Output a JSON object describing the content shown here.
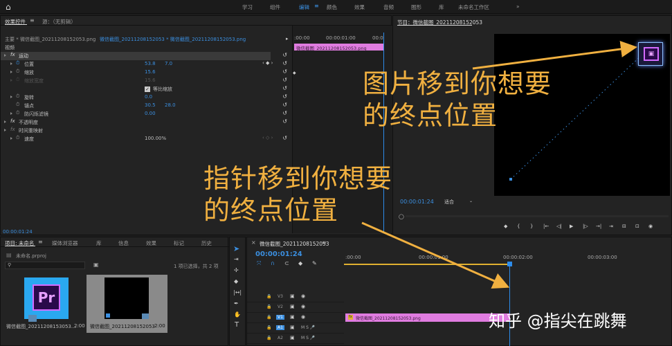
{
  "topbar": {
    "home_icon": "home-icon",
    "nav": [
      "学习",
      "组件",
      "编辑",
      "颜色",
      "效果",
      "音频",
      "图形",
      "库",
      "未命名工作区",
      "»"
    ],
    "active_index": 2
  },
  "effect_controls": {
    "tab_label": "效果控件",
    "tab2_label": "源：（无剪辑）",
    "header_source": "主要 * 微信截图_20211208152053.png",
    "header_clip": "微信截图_20211208152053 * 微信截图_20211208152053.png",
    "section_video": "视频",
    "motion": {
      "label": "运动",
      "position_label": "位置",
      "position_x": "53.8",
      "position_y": "7.0",
      "scale_label": "缩放",
      "scale_value": "15.6",
      "scale_width_label": "缩放宽度",
      "scale_width_value": "15.6",
      "uniform_scale_label": "等比缩放",
      "rotation_label": "旋转",
      "rotation_value": "0.0",
      "anchor_label": "锚点",
      "anchor_x": "30.5",
      "anchor_y": "28.0",
      "antiflicker_label": "防闪烁滤镜",
      "antiflicker_value": "0.00"
    },
    "opacity_label": "不透明度",
    "time_remap_label": "时间重映射",
    "speed_label": "速度",
    "speed_value": "100.00%",
    "timecode": "00:00:01:24",
    "mini_timeline": {
      "start": ":00:00",
      "mid": "00:00:01:00",
      "end": "00:0",
      "clip_label": "微信截图_20211208152053.png"
    }
  },
  "program_monitor": {
    "title": "节目：微信截图_20211208152053",
    "timecode": "00:00:01:24",
    "fit_label": "适合",
    "transport": [
      "◆",
      "{",
      "}",
      "|←",
      "◁|",
      "▶",
      "|▷",
      "→|",
      "⇥",
      "⊟",
      "⊡",
      "◉"
    ]
  },
  "project_panel": {
    "tab_label": "项目: 未命名",
    "tabs": [
      "媒体浏览器",
      "库",
      "信息",
      "效果",
      "标记",
      "历史"
    ],
    "project_file": "未命名.prproj",
    "selection_info": "1 项已选择，共 2 项",
    "items": [
      {
        "name": "微信截图_20211208153053...",
        "duration": "2:00"
      },
      {
        "name": "微信截图_20211208152053",
        "duration": "2:00"
      }
    ]
  },
  "timeline": {
    "title": "微信截图_20211208152053",
    "timecode": "00:00:01:24",
    "ruler": [
      ":00:00",
      "00:00:01:00",
      "00:00:02:00",
      "00:00:03:00"
    ],
    "tracks": [
      "V3",
      "V2",
      "V1",
      "A1",
      "A2"
    ],
    "clip_label": "微信截图_20211208152053.png"
  },
  "annotations": {
    "text1_line1": "图片移到你想要",
    "text1_line2": "的终点位置",
    "text2_line1": "指针移到你想要",
    "text2_line2": "的终点位置"
  },
  "watermark": "知乎 @指尖在跳舞",
  "colors": {
    "accent_blue": "#3b8fe0",
    "clip_pink": "#e07ce0",
    "annotation_orange": "#f0b040",
    "playhead_blue": "#2d8ceb"
  }
}
